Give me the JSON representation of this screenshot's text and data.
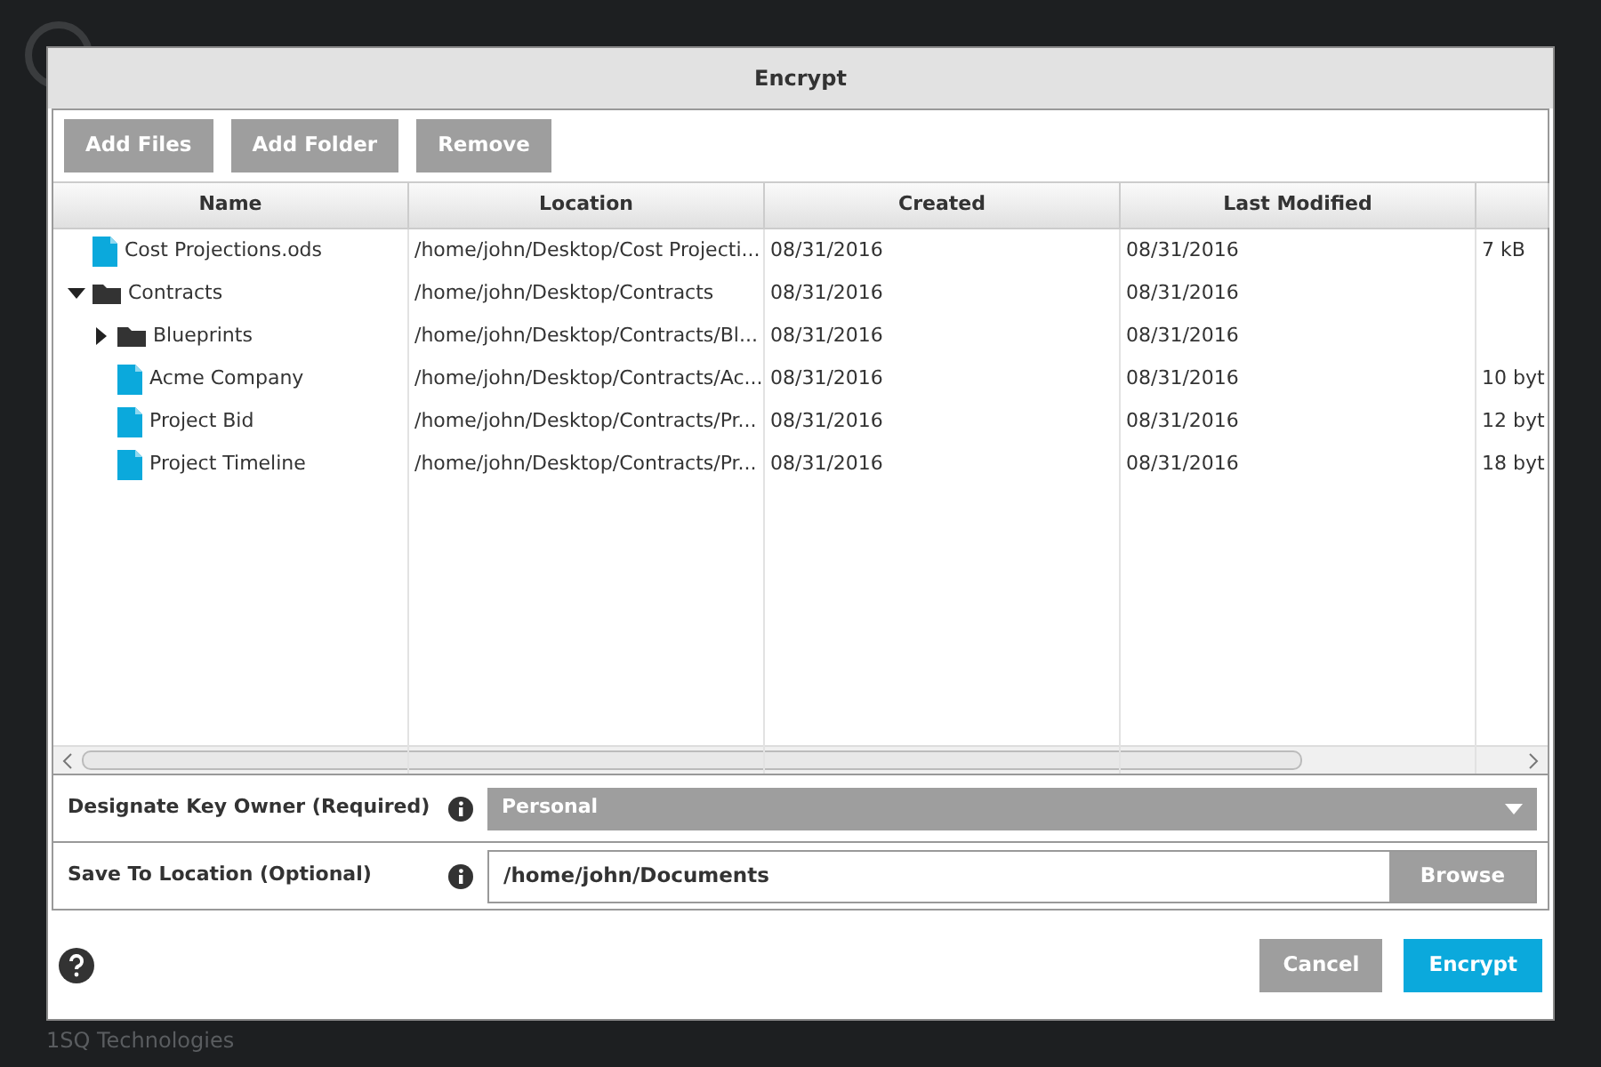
{
  "background": {
    "footer": "1SQ Technologies"
  },
  "dialog": {
    "title": "Encrypt",
    "toolbar": [
      "Add Files",
      "Add Folder",
      "Remove"
    ],
    "table": {
      "columns": [
        "Name",
        "Location",
        "Created",
        "Last Modified"
      ],
      "rows": [
        {
          "kind": "file",
          "name": "Cost Projections.ods",
          "location": "/home/john/Desktop/Cost Projecti...",
          "created": "08/31/2016",
          "modified": "08/31/2016",
          "column_5": "7 kB"
        },
        {
          "kind": "folder",
          "name": "Contracts",
          "expanded": true,
          "location": "/home/john/Desktop/Contracts",
          "created": "08/31/2016",
          "modified": "08/31/2016",
          "children": [
            {
              "kind": "folder",
              "name": "Blueprints",
              "expanded": false,
              "location": "/home/john/Desktop/Contracts/Bl...",
              "created": "08/31/2016",
              "modified": "08/31/2016"
            },
            {
              "kind": "file",
              "name": "Acme Company",
              "location": "/home/john/Desktop/Contracts/Ac...",
              "created": "08/31/2016",
              "modified": "08/31/2016",
              "column_5": "10 byt"
            },
            {
              "kind": "file",
              "name": "Project Bid",
              "location": "/home/john/Desktop/Contracts/Pr...",
              "created": "08/31/2016",
              "modified": "08/31/2016",
              "column_5": "12 byt"
            },
            {
              "kind": "file",
              "name": "Project Timeline",
              "location": "/home/john/Desktop/Contracts/Pr...",
              "created": "08/31/2016",
              "modified": "08/31/2016",
              "column_5": "18 byt"
            }
          ]
        }
      ]
    },
    "key_owner": {
      "label": "Designate Key Owner (Required)",
      "value": "Personal"
    },
    "save_location": {
      "label": "Save To Location (Optional)",
      "value": "/home/john/Documents",
      "button": "Browse"
    },
    "buttons": [
      "Cancel",
      "Encrypt"
    ]
  }
}
